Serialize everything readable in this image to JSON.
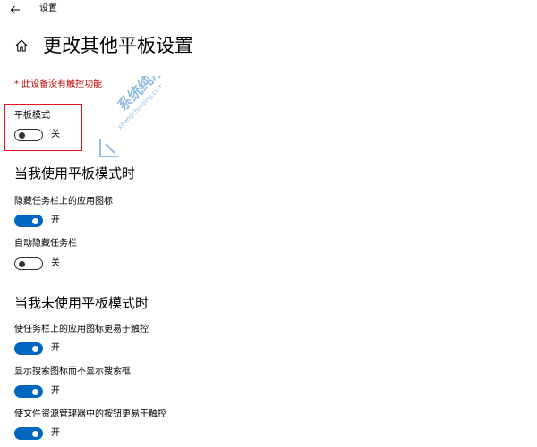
{
  "window": {
    "title": "设置",
    "back_icon": "arrow-left-icon"
  },
  "header": {
    "home_icon": "home-icon",
    "page_title": "更改其他平板设置"
  },
  "warning_text": "* 此设备没有触控功能",
  "tablet_mode": {
    "label": "平板模式",
    "state_label": "关",
    "on": false
  },
  "section_in_tablet": {
    "heading": "当我使用平板模式时",
    "settings": [
      {
        "label": "隐藏任务栏上的应用图标",
        "state_label": "开",
        "on": true
      },
      {
        "label": "自动隐藏任务栏",
        "state_label": "关",
        "on": false
      }
    ]
  },
  "section_not_tablet": {
    "heading": "当我未使用平板模式时",
    "settings": [
      {
        "label": "使任务栏上的应用图标更易于触控",
        "state_label": "开",
        "on": true
      },
      {
        "label": "显示搜索图标而不显示搜索框",
        "state_label": "开",
        "on": true
      },
      {
        "label": "使文件资源管理器中的按钮更易于触控",
        "state_label": "开",
        "on": true
      }
    ]
  },
  "watermark": {
    "text_cn": "系统纯净",
    "text_en": "xitongchunjing.com",
    "color": "#7fb2e0"
  },
  "colors": {
    "accent": "#0067c0",
    "warning": "#c40000",
    "highlight_border": "#e81123"
  }
}
